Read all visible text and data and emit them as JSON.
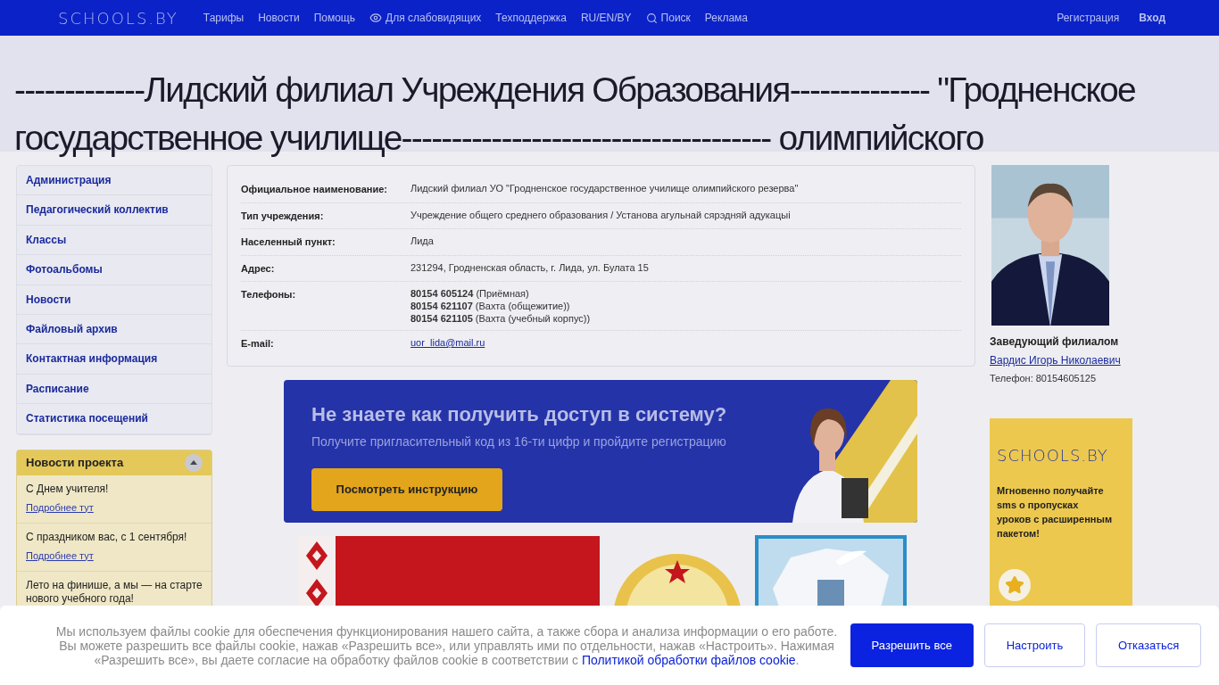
{
  "topbar": {
    "logo": "SCHOOLS.BY",
    "nav": [
      {
        "label": "Тарифы",
        "kind": "plain"
      },
      {
        "label": "Новости",
        "kind": "plain"
      },
      {
        "label": "Помощь",
        "kind": "plain"
      },
      {
        "label": "Для слабовидящих",
        "kind": "vision"
      },
      {
        "label": "Техподдержка",
        "kind": "plain"
      },
      {
        "label": "RU/EN/BY",
        "kind": "plain"
      },
      {
        "label": "Поиск",
        "kind": "search"
      },
      {
        "label": "Реклама",
        "kind": "plain"
      }
    ],
    "right": [
      {
        "label": "Регистрация",
        "bold": false
      },
      {
        "label": "Вход",
        "bold": true
      }
    ]
  },
  "title_lines": [
    "-------------Лидский филиал Учреждения Образования-------------- \"Гродненское",
    "государственное училище------------------------------------- олимпийского"
  ],
  "sidebar": {
    "items": [
      "Администрация",
      "Педагогический коллектив",
      "Классы",
      "Фотоальбомы",
      "Новости",
      "Файловый архив",
      "Контактная информация",
      "Расписание",
      "Статистика посещений"
    ],
    "news": {
      "title": "Новости проекта",
      "expanded": true,
      "items": [
        {
          "text": "С Днем учителя!",
          "link": "Подробнее тут"
        },
        {
          "text": "С праздником вас, с 1 сентября!",
          "link": "Подробнее тут"
        },
        {
          "text": "Лето на финише, а мы — на старте нового учебного года!"
        }
      ]
    }
  },
  "info": {
    "rows": [
      {
        "label": "Официальное наименование:",
        "lines": [
          {
            "text": "Лидский филиал УО \"Гродненское государственное училище олимпийского резерва\""
          }
        ]
      },
      {
        "label": "Тип учреждения:",
        "lines": [
          {
            "text": "Учреждение общего среднего образования / Установа агульнай сярэдняй адукацыі"
          }
        ]
      },
      {
        "label": "Населенный пункт:",
        "lines": [
          {
            "text": "Лида"
          }
        ]
      },
      {
        "label": "Адрес:",
        "lines": [
          {
            "text": "231294, Гродненская область, г. Лида, ул. Булата 15"
          }
        ]
      },
      {
        "label": "Телефоны:",
        "lines": [
          {
            "text": "**80154 605124** (Приёмная)"
          },
          {
            "text": "**80154 621107** (Вахта (общежитие))"
          },
          {
            "text": "**80154 621105** (Вахта (учебный корпус))"
          }
        ]
      },
      {
        "label": "E-mail:",
        "link": "uor_lida@mail.ru"
      }
    ]
  },
  "promo": {
    "title": "Не знаете как получить доступ в систему?",
    "subtitle": "Получите пригласительный код из 16-ти цифр и пройдите регистрацию",
    "button": "Посмотреть инструкцию"
  },
  "director": {
    "role": "Заведующий филиалом",
    "name": "Вардис Игорь Николаевич",
    "phone": "Телефон: 80154605125"
  },
  "ad": {
    "logo": "SCHOOLS.BY",
    "text": "Мгновенно получайте sms о пропусках уроков с расширенным пакетом!"
  },
  "cookie": {
    "text": "Мы используем файлы cookie для обеспечения функционирования нашего сайта, а также сбора и анализа информации о его работе. Вы можете разрешить все файлы cookie, нажав «Разрешить все», или управлять ими по отдельности, нажав «Настроить». Нажимая «Разрешить все», вы даете согласие на обработку файлов cookie в соответствии с",
    "link": "Политикой обработки файлов cookie",
    "end": ".",
    "buttons": [
      {
        "label": "Разрешить все",
        "primary": true
      },
      {
        "label": "Настроить",
        "primary": false
      },
      {
        "label": "Отказаться",
        "primary": false
      }
    ]
  }
}
